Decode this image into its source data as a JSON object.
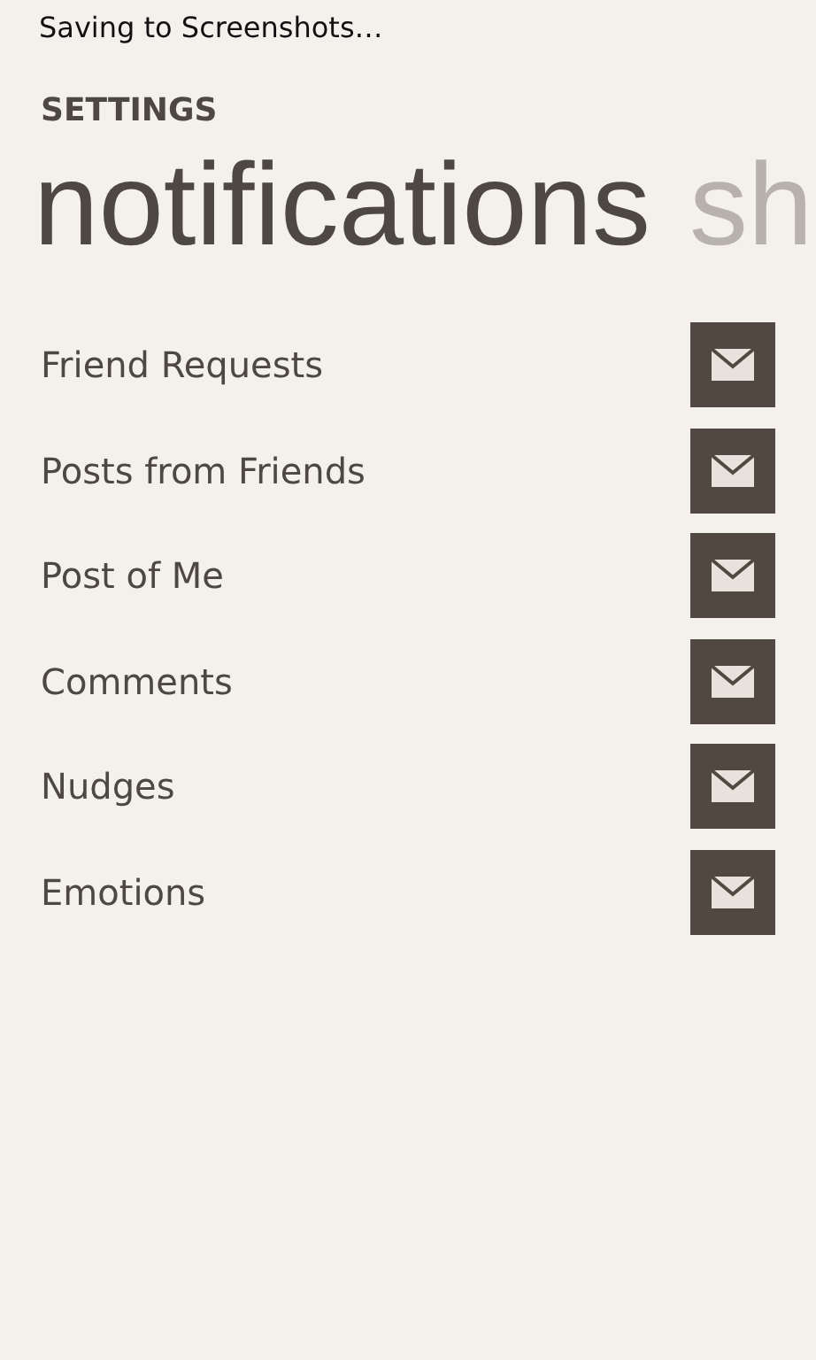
{
  "status_bar": {
    "text": "Saving to Screenshots…"
  },
  "app_title": "SETTINGS",
  "pivot": [
    {
      "label": "notifications",
      "selected": true
    },
    {
      "label": "sh",
      "selected": false
    }
  ],
  "items": [
    {
      "label": "Friend Requests"
    },
    {
      "label": "Posts from Friends"
    },
    {
      "label": "Post of Me"
    },
    {
      "label": "Comments"
    },
    {
      "label": "Nudges"
    },
    {
      "label": "Emotions"
    }
  ]
}
